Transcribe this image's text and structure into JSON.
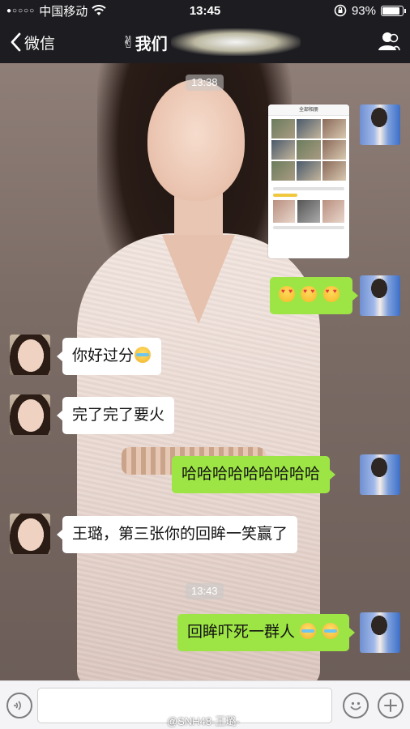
{
  "status_bar": {
    "carrier": "中国移动",
    "signal_dots": "●○○○○",
    "time": "13:45",
    "battery_percent": "93%",
    "battery_level": 0.93
  },
  "nav": {
    "back_label": "微信",
    "title_emoji": "✌",
    "title_visible": "我们"
  },
  "chat": {
    "timestamps": [
      "13:38",
      "13:43"
    ],
    "messages": [
      {
        "side": "right",
        "type": "image",
        "image_title": "全部相册"
      },
      {
        "side": "right",
        "type": "emoji",
        "text": ""
      },
      {
        "side": "left",
        "type": "text",
        "text": "你好过分"
      },
      {
        "side": "left",
        "type": "text",
        "text": "完了完了要火"
      },
      {
        "side": "right",
        "type": "text",
        "text": "哈哈哈哈哈哈哈哈哈"
      },
      {
        "side": "left",
        "type": "text",
        "text": "王璐，第三张你的回眸一笑赢了"
      },
      {
        "side": "right",
        "type": "text",
        "text": "回眸吓死一群人"
      }
    ]
  },
  "input_bar": {
    "placeholder": ""
  },
  "watermark": "@SNH48-王璐-",
  "colors": {
    "right_bubble": "#9de545",
    "left_bubble": "#ffffff",
    "bar_dark": "#1d1c21"
  }
}
